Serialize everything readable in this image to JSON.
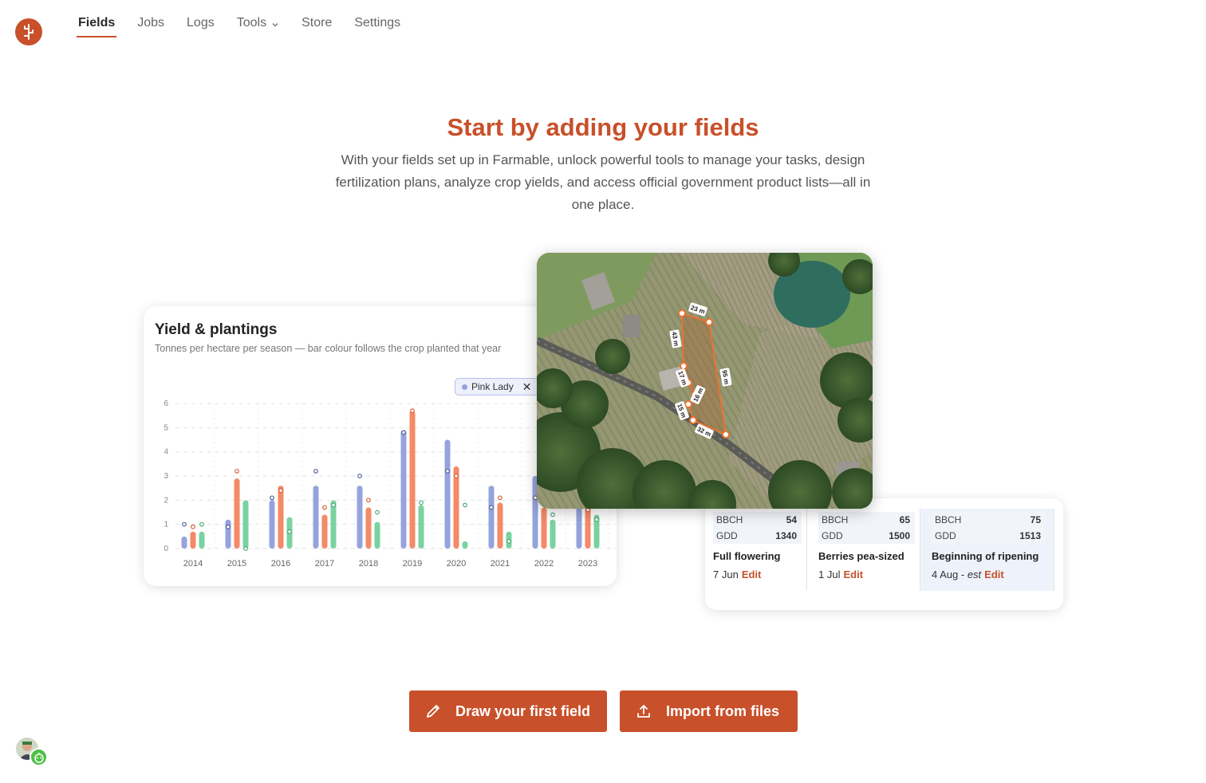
{
  "nav": {
    "items": [
      {
        "label": "Fields",
        "active": true
      },
      {
        "label": "Jobs"
      },
      {
        "label": "Logs"
      },
      {
        "label": "Tools",
        "has_dropdown": true
      },
      {
        "label": "Store"
      },
      {
        "label": "Settings"
      }
    ],
    "icons": {
      "logo": "farmable-logo-icon",
      "dropdown": "chevron-down-icon"
    }
  },
  "hero": {
    "title": "Start by adding your fields",
    "subtitle": "With your fields set up in Farmable, unlock powerful tools to manage your tasks, design fertilization plans, analyze crop yields, and access official government product lists—all in one place."
  },
  "yield_card": {
    "title": "Yield & plantings",
    "subtitle": "Tonnes per hectare per season — bar colour follows the crop planted that year",
    "filter_pill": "Pink Lady",
    "filter_close": "✕"
  },
  "chart_data": {
    "type": "bar",
    "title": "Yield & plantings",
    "categories": [
      "2014",
      "2015",
      "2016",
      "2017",
      "2018",
      "2019",
      "2020",
      "2021",
      "2022",
      "2023"
    ],
    "y_ticks": [
      "0",
      "1",
      "2",
      "3",
      "4",
      "5",
      "6"
    ],
    "ylim": [
      0,
      6
    ],
    "grid": true,
    "series": [
      {
        "color": "#95a3dd",
        "values": [
          0.5,
          1.2,
          2.0,
          2.6,
          2.6,
          4.9,
          4.5,
          2.6,
          3.0,
          2.0
        ],
        "markers": [
          1.0,
          0.9,
          2.1,
          3.2,
          3.0,
          4.8,
          3.2,
          1.7,
          2.1,
          1.8
        ]
      },
      {
        "color": "#f48a66",
        "values": [
          0.7,
          2.9,
          2.6,
          1.4,
          1.7,
          5.7,
          3.4,
          1.9,
          1.7,
          1.8
        ],
        "markers": [
          0.9,
          3.2,
          2.4,
          1.7,
          2.0,
          5.7,
          3.0,
          2.1,
          1.9,
          1.6
        ]
      },
      {
        "color": "#79d3a1",
        "values": [
          0.7,
          2.0,
          1.3,
          2.0,
          1.1,
          1.8,
          0.3,
          0.7,
          1.2,
          1.4
        ],
        "markers": [
          1.0,
          0.0,
          0.7,
          1.8,
          1.5,
          1.9,
          1.8,
          0.3,
          1.4,
          1.2
        ]
      }
    ]
  },
  "map": {
    "measurements": [
      "23 m",
      "43 m",
      "95 m",
      "17 m",
      "16 m",
      "15 m",
      "32 m"
    ]
  },
  "stages": [
    {
      "bbch_label": "BBCH",
      "bbch": "54",
      "gdd_label": "GDD",
      "gdd": "1340",
      "name": "Full flowering",
      "date": "7 Jun",
      "est": "",
      "edit": "Edit"
    },
    {
      "bbch_label": "BBCH",
      "bbch": "65",
      "gdd_label": "GDD",
      "gdd": "1500",
      "name": "Berries pea-sized",
      "date": "1 Jul",
      "est": "",
      "edit": "Edit"
    },
    {
      "bbch_label": "BBCH",
      "bbch": "75",
      "gdd_label": "GDD",
      "gdd": "1513",
      "name": "Beginning of ripening",
      "date": "4 Aug - ",
      "est": "est",
      "edit": "Edit",
      "highlighted": true
    }
  ],
  "buttons": {
    "draw": {
      "label": "Draw your first field",
      "icon": "pencil-icon"
    },
    "import": {
      "label": "Import from files",
      "icon": "upload-icon"
    }
  },
  "colors": {
    "brand": "#c8502a",
    "series_blue": "#95a3dd",
    "series_orange": "#f48a66",
    "series_green": "#79d3a1"
  }
}
